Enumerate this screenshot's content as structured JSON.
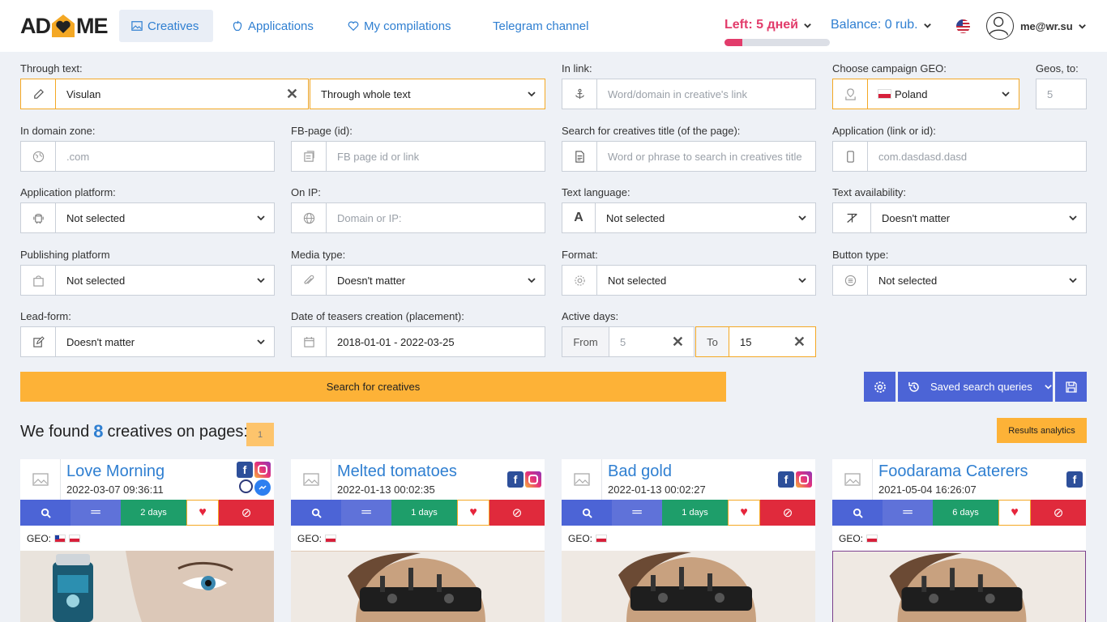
{
  "header": {
    "logo_left": "AD",
    "logo_right": "ME",
    "nav": [
      {
        "label": "Creatives",
        "icon": "image-icon"
      },
      {
        "label": "Applications",
        "icon": "apple-icon"
      },
      {
        "label": "My compilations",
        "icon": "heart-icon"
      },
      {
        "label": "Telegram channel"
      }
    ],
    "left_days": "Left: 5 дней",
    "days_progress": 0.17,
    "balance": "Balance: 0 rub.",
    "language_flag": "us-flag-icon",
    "user_email": "me@wr.su"
  },
  "filters": {
    "through_text": {
      "label": "Through text:",
      "value": "Visulan",
      "mode": "Through whole text"
    },
    "in_link": {
      "label": "In link:",
      "placeholder": "Word/domain in creative's link"
    },
    "campaign_geo": {
      "label": "Choose campaign GEO:",
      "value": "Poland"
    },
    "geos_to": {
      "label": "Geos, to:",
      "placeholder": "5"
    },
    "domain_zone": {
      "label": "In domain zone:",
      "placeholder": ".com"
    },
    "fb_page": {
      "label": "FB-page (id):",
      "placeholder": "FB page id or link"
    },
    "creative_title": {
      "label": "Search for creatives title (of the page):",
      "placeholder": "Word or phrase to search in creatives title"
    },
    "application": {
      "label": "Application (link or id):",
      "placeholder": "com.dasdasd.dasd"
    },
    "app_platform": {
      "label": "Application platform:",
      "value": "Not selected"
    },
    "on_ip": {
      "label": "On IP:",
      "placeholder": "Domain or IP:"
    },
    "text_language": {
      "label": "Text language:",
      "value": "Not selected"
    },
    "text_availability": {
      "label": "Text availability:",
      "value": "Doesn't matter"
    },
    "publishing_platform": {
      "label": "Publishing platform",
      "value": "Not selected"
    },
    "media_type": {
      "label": "Media type:",
      "value": "Doesn't matter"
    },
    "format": {
      "label": "Format:",
      "value": "Not selected"
    },
    "button_type": {
      "label": "Button type:",
      "value": "Not selected"
    },
    "lead_form": {
      "label": "Lead-form:",
      "value": "Doesn't matter"
    },
    "date_creation": {
      "label": "Date of teasers creation (placement):",
      "value": "2018-01-01 - 2022-03-25"
    },
    "active_days": {
      "label": "Active days:",
      "from_label": "From",
      "from_placeholder": "5",
      "to_label": "To",
      "to_value": "15"
    }
  },
  "actions": {
    "search": "Search for creatives",
    "saved_queries": "Saved search queries"
  },
  "results": {
    "prefix": "We found",
    "count": "8",
    "suffix": "creatives on pages:",
    "page": "1",
    "analytics": "Results analytics"
  },
  "cards": [
    {
      "title": "Love Morning",
      "date": "2022-03-07 09:36:11",
      "days": "2 days",
      "geo": "GEO:",
      "platforms": [
        "facebook-icon",
        "instagram-icon",
        "audience-network-icon",
        "messenger-icon"
      ],
      "geo_flags": [
        "chile-flag",
        "poland-flag"
      ]
    },
    {
      "title": "Melted tomatoes",
      "date": "2022-01-13 00:02:35",
      "days": "1 days",
      "geo": "GEO:",
      "platforms": [
        "facebook-icon",
        "instagram-icon"
      ],
      "geo_flags": [
        "poland-flag"
      ]
    },
    {
      "title": "Bad gold",
      "date": "2022-01-13 00:02:27",
      "days": "1 days",
      "geo": "GEO:",
      "platforms": [
        "facebook-icon",
        "instagram-icon"
      ],
      "geo_flags": [
        "poland-flag"
      ]
    },
    {
      "title": "Foodarama Caterers",
      "date": "2021-05-04 16:26:07",
      "days": "6 days",
      "geo": "GEO:",
      "platforms": [
        "facebook-icon"
      ],
      "geo_flags": [
        "poland-flag"
      ]
    }
  ],
  "colors": {
    "accent": "#2f7fd1",
    "orange": "#fdb237",
    "indigo": "#4c64d6",
    "green": "#1e9e6a",
    "red": "#e02a3c",
    "pink": "#e23c6b"
  }
}
